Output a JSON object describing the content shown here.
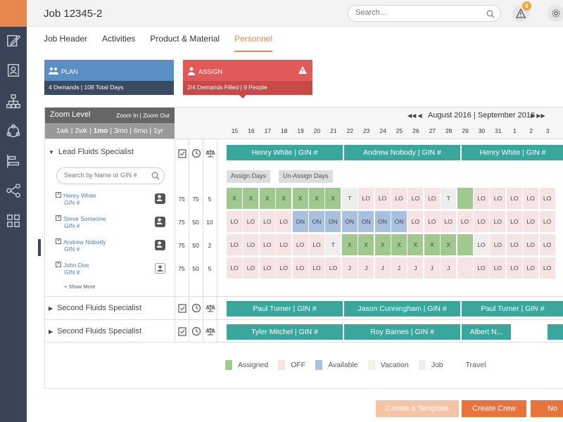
{
  "header": {
    "title": "Job 12345-2",
    "search_placeholder": "Search...",
    "alert_count": "9"
  },
  "tabs": [
    {
      "label": "Job Header"
    },
    {
      "label": "Activities"
    },
    {
      "label": "Product & Material"
    },
    {
      "label": "Personnel"
    }
  ],
  "cards": {
    "plan": {
      "title": "PLAN",
      "summary": "4 Demands | 108 Total Days"
    },
    "assign": {
      "title": "ASSIGN",
      "summary": "2/4 Demands  Filled | 9 People"
    }
  },
  "zoom": {
    "label": "Zoom Level",
    "zoom_in": "Zoom In",
    "zoom_out": "Zoom Out",
    "sep": "|",
    "options": [
      "1wk",
      "2wk",
      "1mo",
      "3mo",
      "6mo",
      "1yr"
    ],
    "selected": "1mo"
  },
  "timeline": {
    "nav_prev": "◀◀ ◀",
    "month_label": "August 2016 | September 2016",
    "nav_next": "▶ ▶▶",
    "days": [
      "15",
      "16",
      "17",
      "18",
      "19",
      "20",
      "21",
      "22",
      "23",
      "24",
      "25",
      "26",
      "27",
      "28",
      "29",
      "30",
      "31",
      "1",
      "2",
      "3"
    ]
  },
  "roles": [
    {
      "name": "Lead Fluids Specialist",
      "expanded": true,
      "bars": [
        "Henry White | GIN #",
        "Andrew Nobody | GIN #",
        "Henry White | GIN #"
      ],
      "search_placeholder": "Search by Name or GIN #",
      "assign_label": "Assign Days",
      "unassign_label": "Un-Assign Days",
      "people": [
        {
          "name": "Henry White",
          "gin": "GIN #",
          "v1": "75",
          "v2": "75",
          "v3": "5",
          "cells": [
            "X",
            "X",
            "X",
            "X",
            "X",
            "X",
            "X",
            "T",
            "LO",
            "LO",
            "LO",
            "LO",
            "LO",
            "T",
            "",
            "LO",
            "LO",
            "LO",
            "LO",
            "LO"
          ],
          "status": [
            "a",
            "a",
            "a",
            "a",
            "a",
            "a",
            "a",
            "j",
            "o",
            "o",
            "o",
            "o",
            "o",
            "j",
            "a",
            "o",
            "o",
            "o",
            "o",
            "o"
          ]
        },
        {
          "name": "Steve Someone",
          "gin": "GIN #",
          "v1": "75",
          "v2": "50",
          "v3": "10",
          "cells": [
            "LO",
            "LO",
            "LO",
            "LO",
            "ON",
            "ON",
            "ON",
            "ON",
            "ON",
            "ON",
            "ON",
            "LO",
            "LO",
            "LO",
            "LO",
            "LO",
            "LO",
            "LO",
            "LO",
            "LO"
          ],
          "status": [
            "o",
            "o",
            "o",
            "o",
            "v",
            "v",
            "v",
            "v",
            "v",
            "v",
            "v",
            "o",
            "o",
            "o",
            "o",
            "o",
            "o",
            "o",
            "o",
            "o"
          ]
        },
        {
          "name": "Andrew Nobody",
          "gin": "GIN #",
          "v1": "75",
          "v2": "50",
          "v3": "2",
          "cells": [
            "LO",
            "LO",
            "LO",
            "LO",
            "LO",
            "LO",
            "T",
            "X",
            "X",
            "X",
            "X",
            "X",
            "X",
            "X",
            "",
            "LO",
            "LO",
            "LO",
            "LO",
            "LO"
          ],
          "status": [
            "o",
            "o",
            "o",
            "o",
            "o",
            "o",
            "j",
            "a",
            "a",
            "a",
            "a",
            "a",
            "a",
            "a",
            "a",
            "j",
            "o",
            "o",
            "o",
            "o"
          ]
        },
        {
          "name": "John Doe",
          "gin": "GIN #",
          "v1": "75",
          "v2": "50",
          "v3": "5",
          "cells": [
            "LO",
            "LO",
            "LO",
            "LO",
            "LO",
            "LO",
            "LO",
            "J",
            "J",
            "J",
            "J",
            "J",
            "J",
            "J",
            "",
            "LO",
            "LO",
            "LO",
            "LO",
            "LO"
          ],
          "status": [
            "o",
            "o",
            "o",
            "o",
            "o",
            "o",
            "o",
            "o",
            "o",
            "o",
            "o",
            "o",
            "o",
            "o",
            "o",
            "o",
            "o",
            "o",
            "o",
            "o"
          ]
        }
      ],
      "show_more": "+ Show More"
    },
    {
      "name": "Second Fluids Specialist",
      "expanded": false,
      "bars": [
        "Paul Turner | GIN #",
        "Jason Cunningham | GIN #",
        "Paul Turner | GIN #"
      ]
    },
    {
      "name": "Second Fluids Specialist",
      "expanded": false,
      "bars": [
        "Tyler Mitchel | GIN #",
        "Roy Barnes | GIN #",
        "Albert N..."
      ]
    }
  ],
  "legend": [
    {
      "label": "Assigned",
      "color": "#9fc98e"
    },
    {
      "label": "OFF",
      "color": "#f6e3e3"
    },
    {
      "label": "Available",
      "color": "#a9c1de"
    },
    {
      "label": "Vacation",
      "color": "#f6f2dc"
    },
    {
      "label": "Job",
      "color": "#eeeeee"
    },
    {
      "label": "Travel",
      "color": "#ffffff"
    }
  ],
  "buttons": {
    "create_template": "Create a Template",
    "create_crew": "Create Crew",
    "next": "No"
  },
  "colors": {
    "accent": "#e8864f",
    "teal": "#3aa79c",
    "plan_blue": "#5b8ec4",
    "assign_red": "#e25a57",
    "rail": "#394456"
  }
}
